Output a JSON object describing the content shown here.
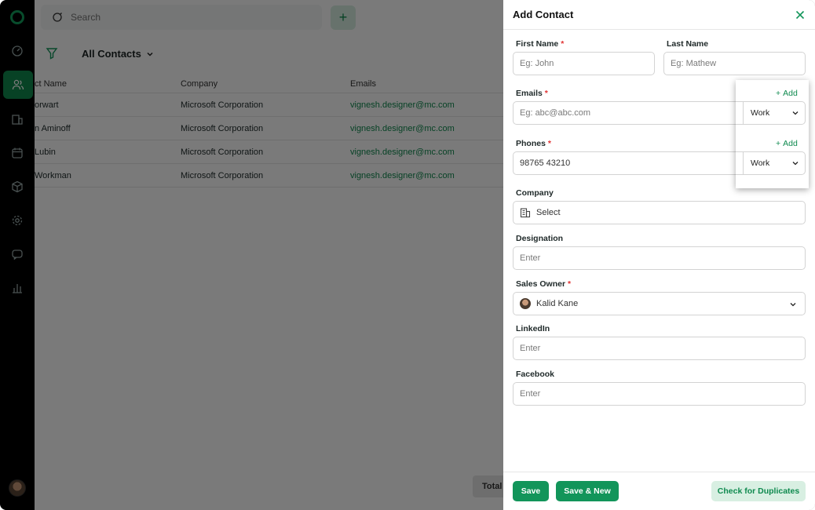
{
  "search": {
    "placeholder": "Search"
  },
  "view": {
    "label": "All Contacts"
  },
  "table": {
    "headers": [
      "ct Name",
      "Company",
      "Emails"
    ],
    "rows": [
      {
        "name": "orwart",
        "company": "Microsoft Corporation",
        "email": "vignesh.designer@mc.com"
      },
      {
        "name": "n Aminoff",
        "company": "Microsoft Corporation",
        "email": "vignesh.designer@mc.com"
      },
      {
        "name": "Lubin",
        "company": "Microsoft Corporation",
        "email": "vignesh.designer@mc.com"
      },
      {
        "name": "Workman",
        "company": "Microsoft Corporation",
        "email": "vignesh.designer@mc.com"
      }
    ]
  },
  "total_label": "Total",
  "drawer": {
    "title": "Add Contact",
    "first_name": {
      "label": "First Name",
      "placeholder": "Eg: John"
    },
    "last_name": {
      "label": "Last Name",
      "placeholder": "Eg:  Mathew"
    },
    "emails": {
      "label": "Emails",
      "add": "Add",
      "placeholder": "Eg: abc@abc.com",
      "type": "Work"
    },
    "phones": {
      "label": "Phones",
      "add": "Add",
      "value": "98765 43210",
      "type": "Work"
    },
    "company": {
      "label": "Company",
      "placeholder": "Select"
    },
    "designation": {
      "label": "Designation",
      "placeholder": "Enter"
    },
    "sales_owner": {
      "label": "Sales Owner",
      "value": "Kalid Kane"
    },
    "linkedin": {
      "label": "LinkedIn",
      "placeholder": "Enter"
    },
    "facebook": {
      "label": "Facebook",
      "placeholder": "Enter"
    },
    "required_mark": "*",
    "buttons": {
      "save": "Save",
      "save_new": "Save & New",
      "duplicates": "Check for Duplicates"
    }
  },
  "colors": {
    "accent": "#12955a",
    "sidebar": "#000000",
    "required": "#e13333"
  }
}
